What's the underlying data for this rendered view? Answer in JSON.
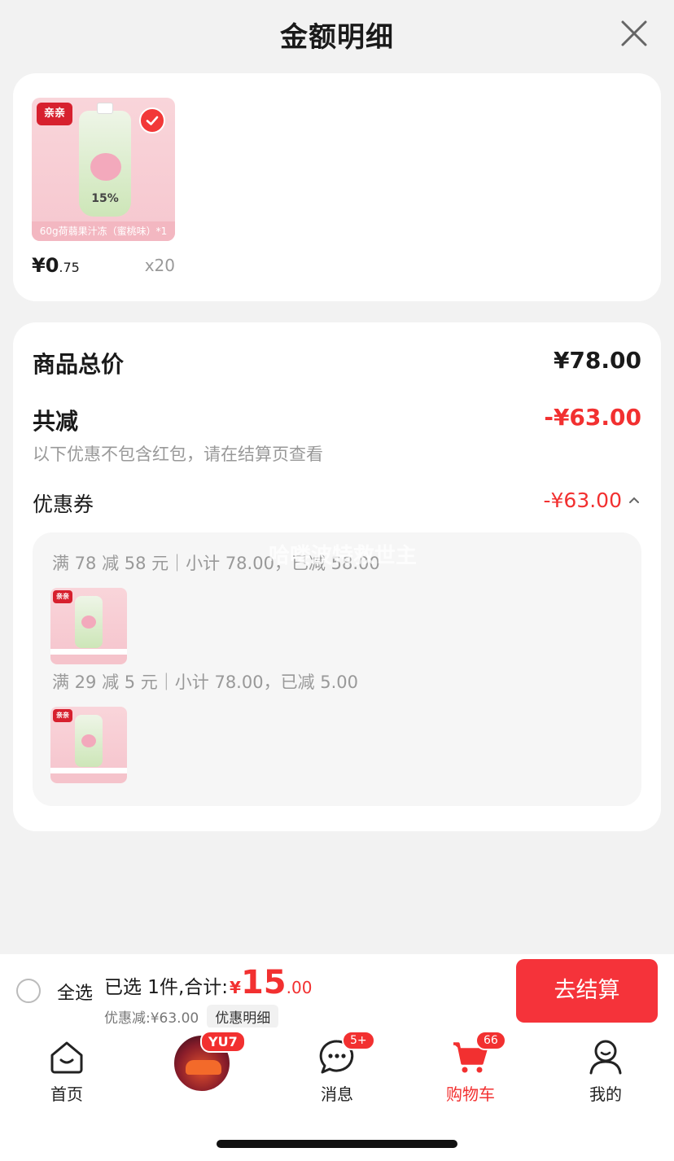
{
  "header": {
    "title": "金额明细"
  },
  "product": {
    "image_strip": "60g荷蒻果汁冻（蜜桃味）*1",
    "brand": "亲亲",
    "percent": "15%",
    "price_main": "¥0",
    "price_cents": ".75",
    "qty": "x20"
  },
  "detail": {
    "total_label": "商品总价",
    "total_value": "¥78.00",
    "reduce_label": "共减",
    "reduce_value": "-¥63.00",
    "note": "以下优惠不包含红包，请在结算页查看",
    "coupon_label": "优惠券",
    "coupon_value": "-¥63.00",
    "coupons": [
      {
        "text": "满 78 减 58 元｜小计 78.00，已减 58.00"
      },
      {
        "text": "满 29 减 5 元｜小计 78.00，已减 5.00"
      }
    ]
  },
  "watermark": "哈喽波特救世主",
  "checkout": {
    "select_all": "全选",
    "selected_text": "已选 1件,合计:",
    "currency": "¥",
    "total_int": "15",
    "total_dec": ".00",
    "discount_text": "优惠减:¥63.00",
    "discount_detail_btn": "优惠明细",
    "checkout_btn": "去结算"
  },
  "tabbar": {
    "home": "首页",
    "avatar_badge": "YU7",
    "messages": "消息",
    "messages_badge": "5+",
    "cart": "购物车",
    "cart_badge": "66",
    "me": "我的"
  },
  "colors": {
    "accent": "#f23030",
    "checkout_btn": "#f5333a",
    "bg": "#f2f2f2"
  }
}
